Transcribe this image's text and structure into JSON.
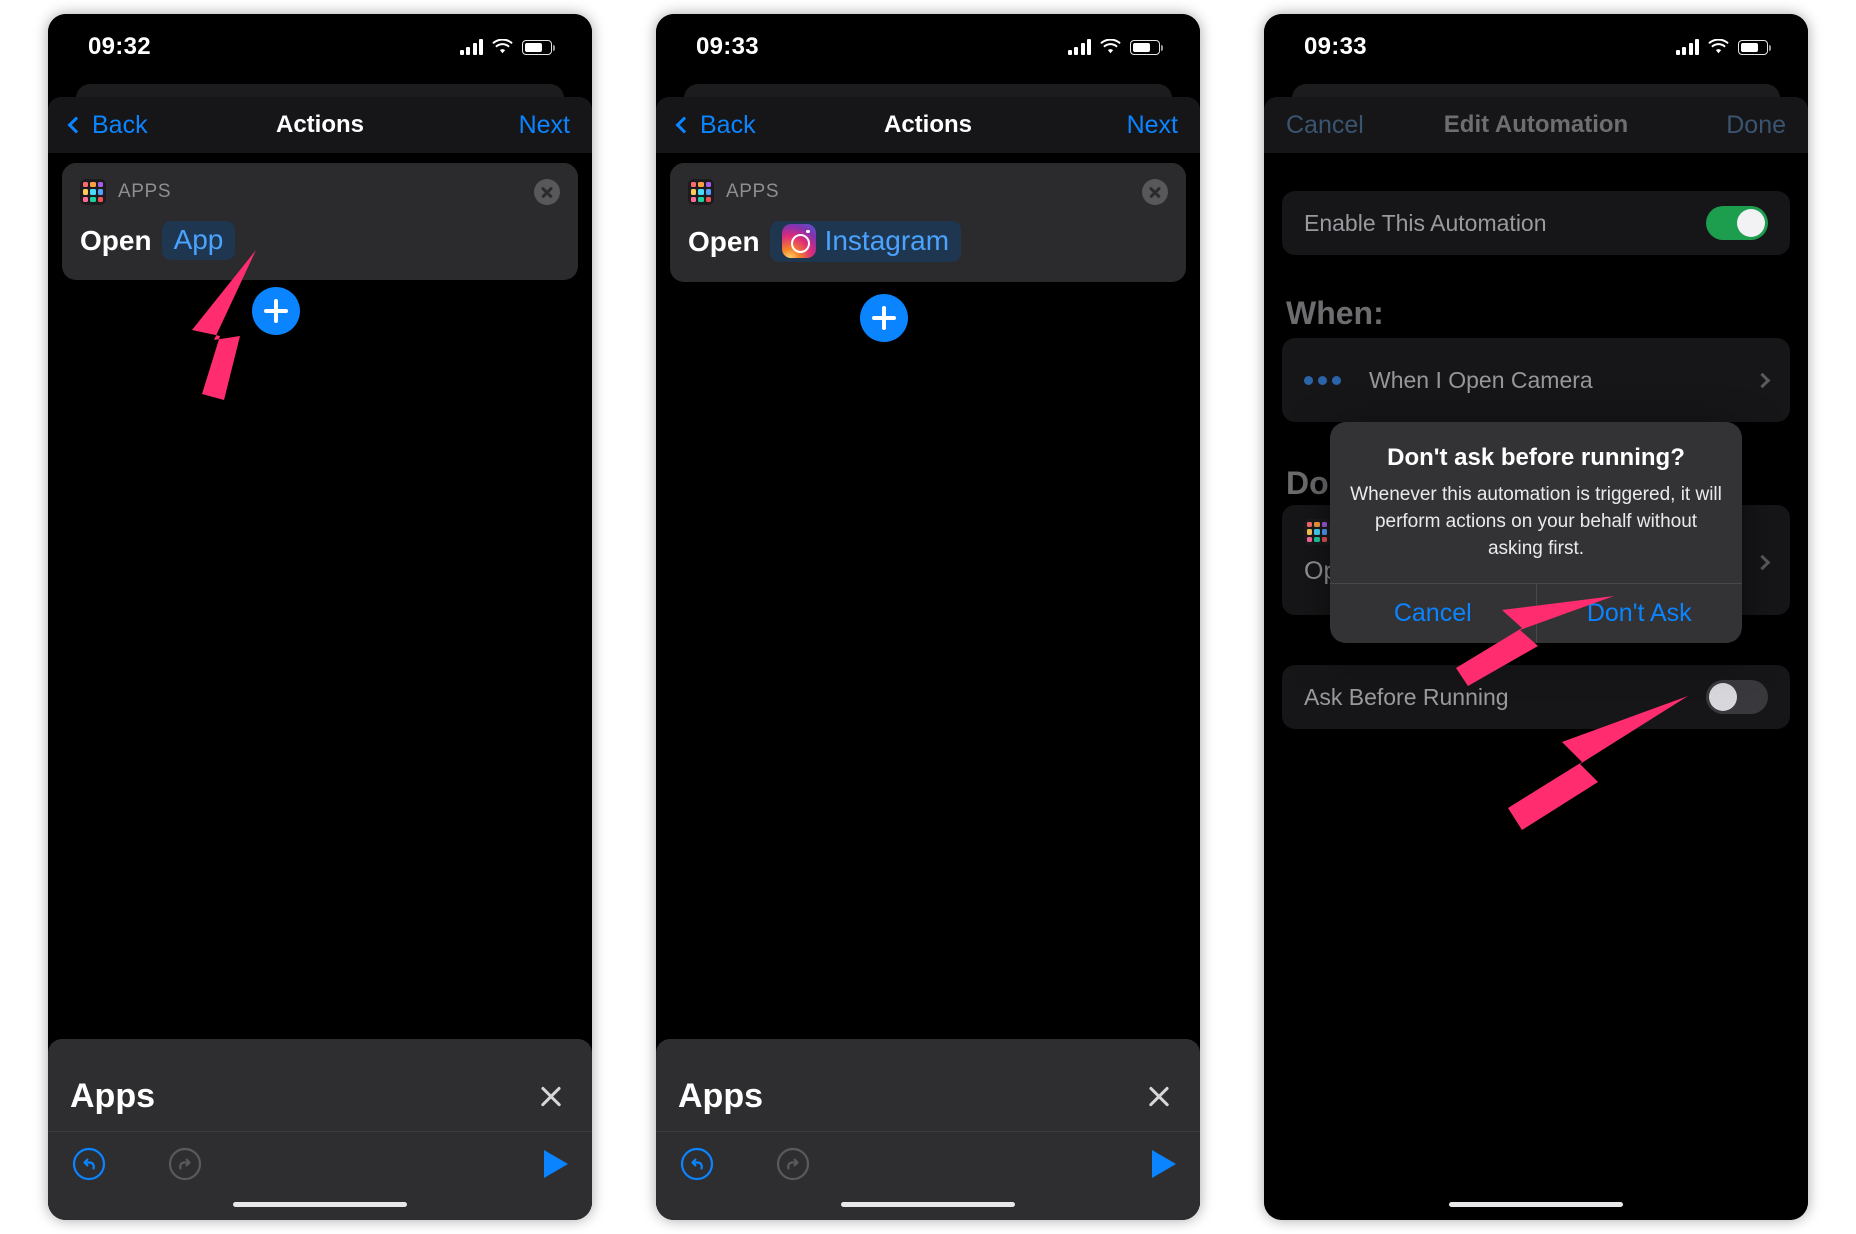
{
  "accent": {
    "ios_blue": "#0a84ff",
    "arrow_pink": "#ff2d6f",
    "toggle_green": "#1d9d4e"
  },
  "screens": [
    {
      "id": "screen-actions-app",
      "status": {
        "time": "09:32"
      },
      "nav": {
        "back": "Back",
        "title": "Actions",
        "next": "Next"
      },
      "action_card": {
        "app_label": "APPS",
        "verb": "Open",
        "token": "App",
        "token_icon": "apps-grid-icon"
      },
      "sheet": {
        "title": "Apps"
      }
    },
    {
      "id": "screen-actions-instagram",
      "status": {
        "time": "09:33"
      },
      "nav": {
        "back": "Back",
        "title": "Actions",
        "next": "Next"
      },
      "action_card": {
        "app_label": "APPS",
        "verb": "Open",
        "token": "Instagram",
        "token_icon": "instagram-icon"
      },
      "sheet": {
        "title": "Apps"
      }
    },
    {
      "id": "screen-edit-automation",
      "status": {
        "time": "09:33"
      },
      "nav": {
        "cancel": "Cancel",
        "title": "Edit Automation",
        "done": "Done"
      },
      "rows": {
        "enable_label": "Enable This Automation",
        "enable_state": "on",
        "ask_label": "Ask Before Running",
        "ask_state": "off"
      },
      "sections": {
        "when": "When:",
        "do": "Do:"
      },
      "trigger": {
        "text": "When I Open Camera"
      },
      "do_action": {
        "verb": "Op"
      },
      "alert": {
        "title": "Don't ask before running?",
        "message": "Whenever this automation is triggered, it will perform actions on your behalf without asking first.",
        "cancel": "Cancel",
        "confirm": "Don't Ask"
      }
    }
  ]
}
